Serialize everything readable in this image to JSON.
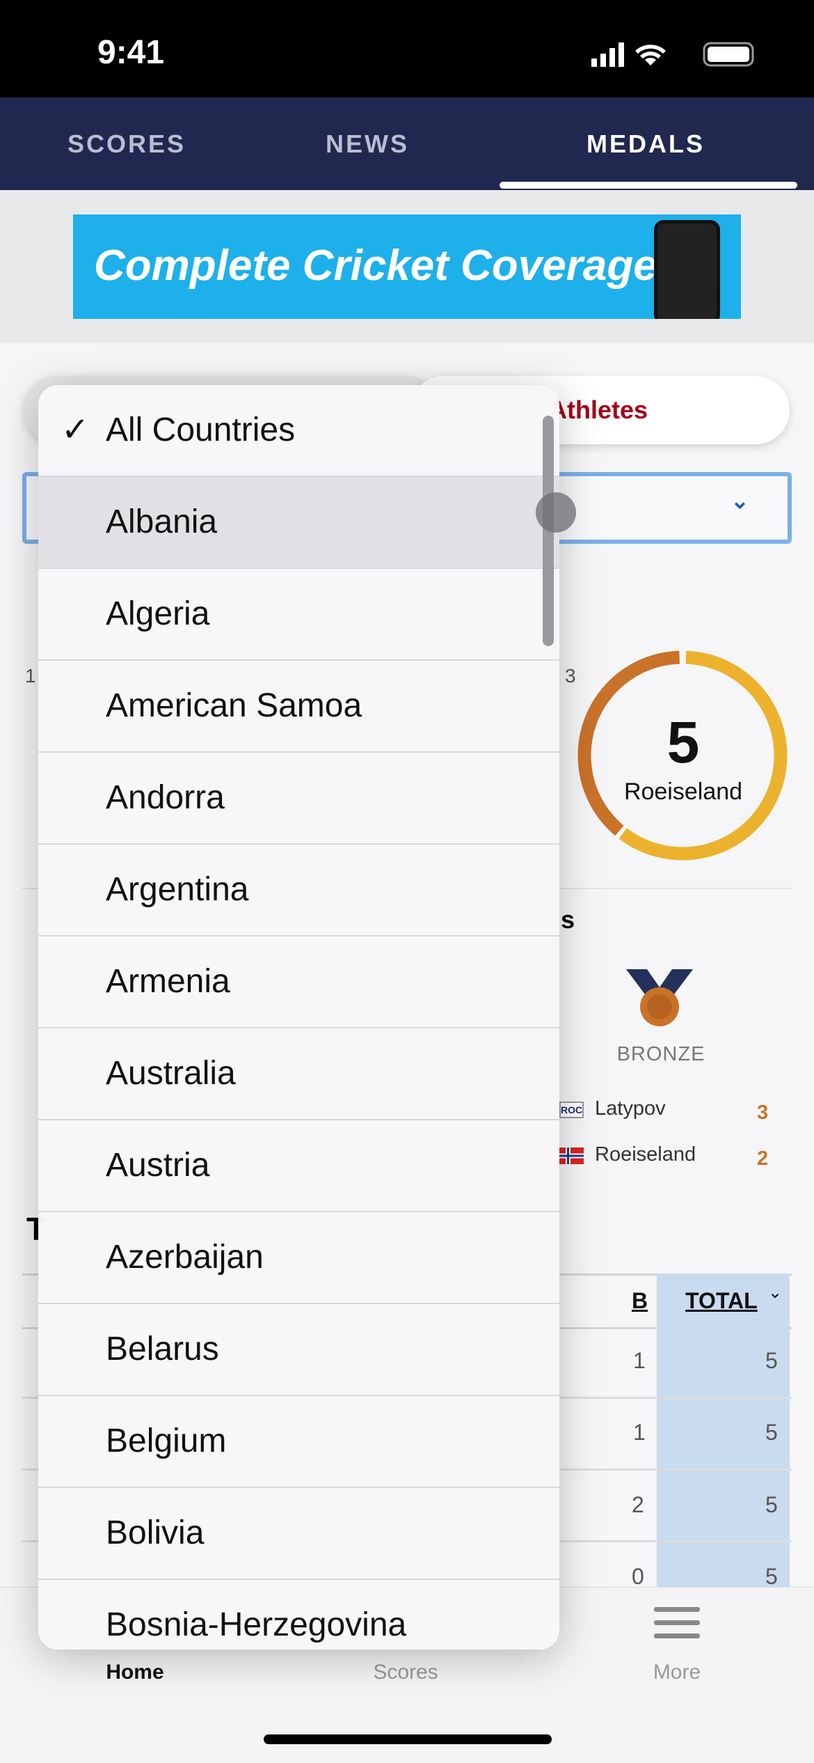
{
  "status_bar": {
    "time": "9:41"
  },
  "top_nav": {
    "tabs": [
      {
        "label": "SCORES"
      },
      {
        "label": "NEWS"
      },
      {
        "label": "MEDALS",
        "active": true
      }
    ]
  },
  "ad_banner": {
    "text": "Complete Cricket Coverage"
  },
  "segment": {
    "right_label": "Athletes"
  },
  "medal_leaders": {
    "partial_left_num": "1",
    "partial_right_num": "3",
    "donut_total": "5",
    "donut_name": "Roeiseland",
    "section_partial": "s",
    "bronze_label": "BRONZE",
    "bronze_leaders": [
      {
        "name": "Latypov",
        "flag": "ROC",
        "count": "3"
      },
      {
        "name": "Roeiseland",
        "flag": "Norway",
        "count": "2"
      }
    ]
  },
  "table": {
    "partial_title": "T",
    "headers": {
      "b": "B",
      "total": "TOTAL"
    },
    "rows": [
      {
        "b": "1",
        "total": "5"
      },
      {
        "b": "1",
        "total": "5"
      },
      {
        "b": "2",
        "total": "5"
      },
      {
        "b": "0",
        "total": "5"
      }
    ]
  },
  "dropdown": {
    "options": [
      "All Countries",
      "Albania",
      "Algeria",
      "American Samoa",
      "Andorra",
      "Argentina",
      "Armenia",
      "Australia",
      "Austria",
      "Azerbaijan",
      "Belarus",
      "Belgium",
      "Bolivia",
      "Bosnia-Herzegovina"
    ],
    "selected": "All Countries",
    "check": "✓"
  },
  "bottom_tabs": [
    {
      "label": "Home",
      "active": true
    },
    {
      "label": "Scores"
    },
    {
      "label": "More"
    }
  ],
  "colors": {
    "nav": "#20284f",
    "gold": "#ecb22e",
    "bronze": "#c9722a",
    "accent_red": "#a5001a",
    "select_border": "#7ab0ea"
  }
}
